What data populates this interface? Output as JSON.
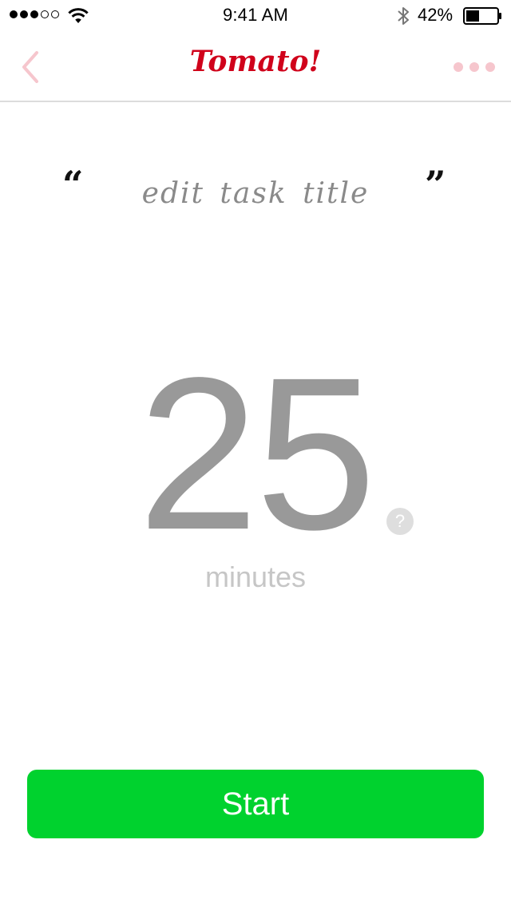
{
  "status_bar": {
    "time": "9:41 AM",
    "battery_percent": "42%",
    "signal_strength": 3,
    "signal_max": 5,
    "battery_level": 0.42,
    "icons": [
      "signal-dots-icon",
      "wifi-icon",
      "bluetooth-icon",
      "battery-icon"
    ]
  },
  "nav": {
    "title": "Tomato!",
    "back_icon": "chevron-left-icon",
    "more_icon": "more-dots-icon",
    "title_color": "#d0021b",
    "icon_color": "#f6c6cd"
  },
  "task": {
    "open_quote": "“",
    "close_quote": "”",
    "title_placeholder": "edit task title"
  },
  "timer": {
    "value": "25",
    "unit": "minutes",
    "help_label": "?"
  },
  "actions": {
    "start_label": "Start",
    "start_color": "#00d22e"
  }
}
